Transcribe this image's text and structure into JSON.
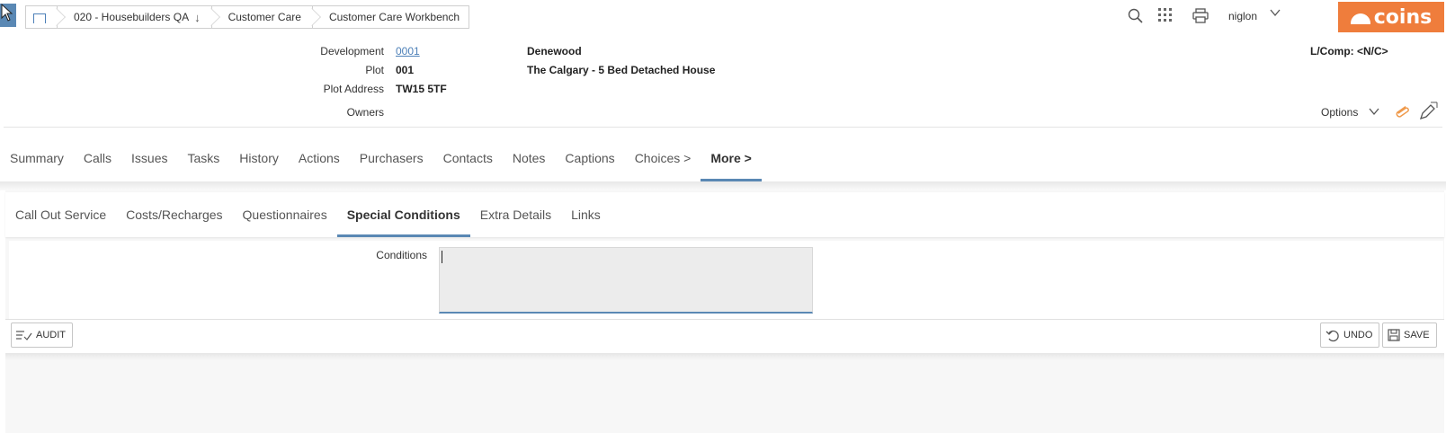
{
  "breadcrumbs": {
    "items": [
      {
        "label": ""
      },
      {
        "label": "020 - Housebuilders QA"
      },
      {
        "label": "Customer Care"
      },
      {
        "label": "Customer Care Workbench"
      }
    ]
  },
  "topbar": {
    "user": "niglon",
    "logo_text": "coins",
    "brand_color": "#ef7d3c"
  },
  "header": {
    "development_label": "Development",
    "development_code": "0001",
    "development_name": "Denewood",
    "plot_label": "Plot",
    "plot_value": "001",
    "plot_name": "The Calgary - 5 Bed Detached House",
    "plot_address_label": "Plot Address",
    "plot_address_value": "TW15 5TF",
    "owners_label": "Owners",
    "lcomp": "L/Comp: <N/C>",
    "options_label": "Options"
  },
  "tabs": [
    {
      "label": "Summary"
    },
    {
      "label": "Calls"
    },
    {
      "label": "Issues"
    },
    {
      "label": "Tasks"
    },
    {
      "label": "History"
    },
    {
      "label": "Actions"
    },
    {
      "label": "Purchasers"
    },
    {
      "label": "Contacts"
    },
    {
      "label": "Notes"
    },
    {
      "label": "Captions"
    },
    {
      "label": "Choices >"
    },
    {
      "label": "More >"
    }
  ],
  "subtabs": [
    {
      "label": "Call Out Service"
    },
    {
      "label": "Costs/Recharges"
    },
    {
      "label": "Questionnaires"
    },
    {
      "label": "Special Conditions"
    },
    {
      "label": "Extra Details"
    },
    {
      "label": "Links"
    }
  ],
  "form": {
    "conditions_label": "Conditions",
    "conditions_value": ""
  },
  "buttons": {
    "audit": "AUDIT",
    "undo": "UNDO",
    "save": "SAVE"
  }
}
